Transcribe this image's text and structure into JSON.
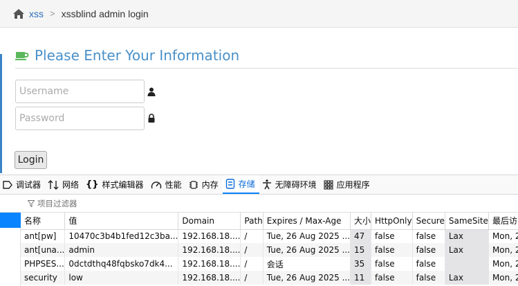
{
  "breadcrumb": {
    "link": "xss",
    "sep": ">",
    "current": "xssblind admin login"
  },
  "form": {
    "title": "Please Enter Your Information",
    "username_placeholder": "Username",
    "password_placeholder": "Password",
    "login_label": "Login"
  },
  "devtools": {
    "tabs": [
      {
        "label": "调试器",
        "icon": "debugger-icon"
      },
      {
        "label": "网络",
        "icon": "network-icon"
      },
      {
        "label": "样式编辑器",
        "icon": "braces-icon"
      },
      {
        "label": "性能",
        "icon": "gauge-icon"
      },
      {
        "label": "内存",
        "icon": "memory-chip-icon"
      },
      {
        "label": "存储",
        "icon": "storage-icon"
      },
      {
        "label": "无障碍环境",
        "icon": "accessibility-icon"
      },
      {
        "label": "应用程序",
        "icon": "app-grid-icon"
      }
    ],
    "active_tab": "存储",
    "filter_placeholder": "项目过滤器",
    "columns": [
      "名称",
      "值",
      "Domain",
      "Path",
      "Expires / Max-Age",
      "大小",
      "HttpOnly",
      "Secure",
      "SameSite",
      "最后访问"
    ],
    "rows": [
      [
        "ant[pw]",
        "10470c3b4b1fed12c3ba...",
        "192.168.18....",
        "/",
        "Tue, 26 Aug 2025 ...",
        "47",
        "false",
        "false",
        "Lax",
        "Mon, 2"
      ],
      [
        "ant[una...",
        "admin",
        "192.168.18....",
        "/",
        "Tue, 26 Aug 2025 ...",
        "15",
        "false",
        "false",
        "Lax",
        "Mon, 2"
      ],
      [
        "PHPSES...",
        "0dctdthq48fqbsko7dk4...",
        "192.168.18....",
        "/",
        "会话",
        "35",
        "false",
        "false",
        "",
        "Mon, 2"
      ],
      [
        "security",
        "low",
        "192.168.18....",
        "/",
        "Tue, 26 Aug 2025 ...",
        "11",
        "false",
        "false",
        "Lax",
        "Mon, 2"
      ]
    ]
  }
}
